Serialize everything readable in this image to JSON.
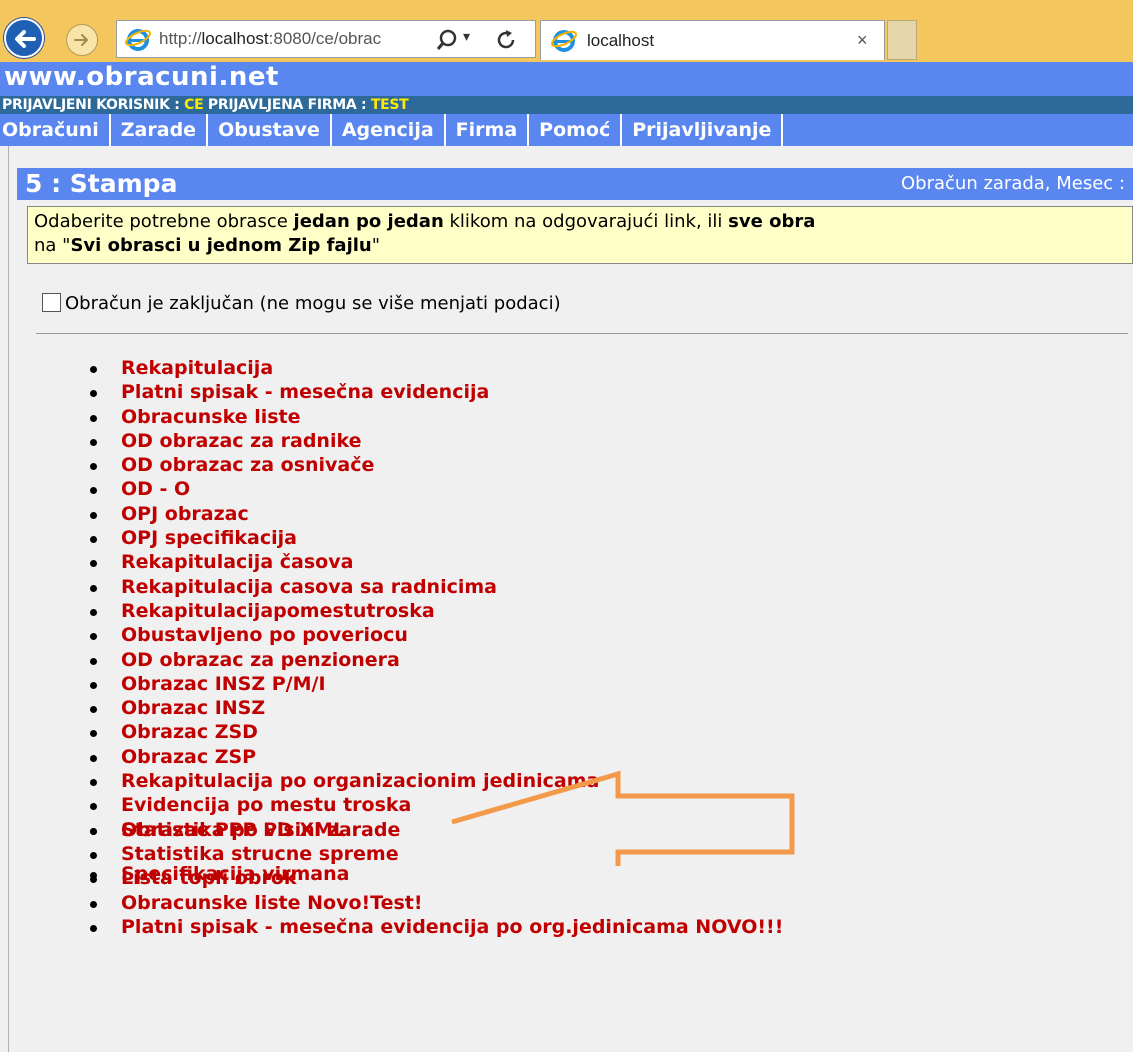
{
  "browser": {
    "url_prefix": "http://",
    "url_host": "localhost",
    "url_rest": ":8080/ce/obrac",
    "tab_title": "localhost",
    "tab_close": "×",
    "dropdown": "▾"
  },
  "site": {
    "title": "www.obracuni.net",
    "user_label": "PRIJAVLJENI KORISNIK : ",
    "user_value": "CE",
    "firm_label": " PRIJAVLJENA FIRMA : ",
    "firm_value": "TEST"
  },
  "menu": [
    "Obračuni",
    "Zarade",
    "Obustave",
    "Agencija",
    "Firma",
    "Pomoć",
    "Prijavljivanje"
  ],
  "panel": {
    "title": "5 : Stampa",
    "info": "Obračun zarada, Mesec :"
  },
  "instructions": {
    "l1_a": "Odaberite potrebne obrasce ",
    "l1_b": "jedan po jedan",
    "l1_c": " klikom na odgovarajući link, ili ",
    "l1_d": "sve obra",
    "l2_a": "na \"",
    "l2_b": "Svi obrasci u jednom Zip fajlu",
    "l2_c": "\""
  },
  "lock_label": "Obračun je zaključan (ne mogu se više menjati podaci)",
  "reports": [
    "Rekapitulacija",
    "Platni spisak - mesečna evidencija",
    "Obracunske liste",
    "OD obrazac za radnike",
    "OD obrazac za osnivače",
    "OD - O",
    "OPJ obrazac",
    "OPJ specifikacija",
    "Rekapitulacija časova",
    "Rekapitulacija casova sa radnicima",
    "Rekapitulacijapomestutroska",
    "Obustavljeno po poveriocu",
    "OD obrazac za penzionera",
    "Obrazac INSZ P/M/I",
    "Obrazac INSZ",
    "Obrazac ZSD",
    "Obrazac ZSP",
    "Rekapitulacija po organizacionim jedinicama",
    "Evidencija po mestu troska",
    "Statistika po visini zarade",
    "Statistika strucne spreme",
    "Lista topli obrok",
    "Obracunske liste Novo!Test!",
    "Platni spisak - mesečna evidencija po org.jedinicama NOVO!!!"
  ],
  "extra_reports": [
    "Obrazac PPP PD XML",
    "Specifikacija virmana"
  ],
  "colors": {
    "header_blue": "#5a86f0",
    "link_red": "#c00000",
    "arrow_orange": "#f39a4a",
    "note_yellow": "#ffffc8"
  }
}
